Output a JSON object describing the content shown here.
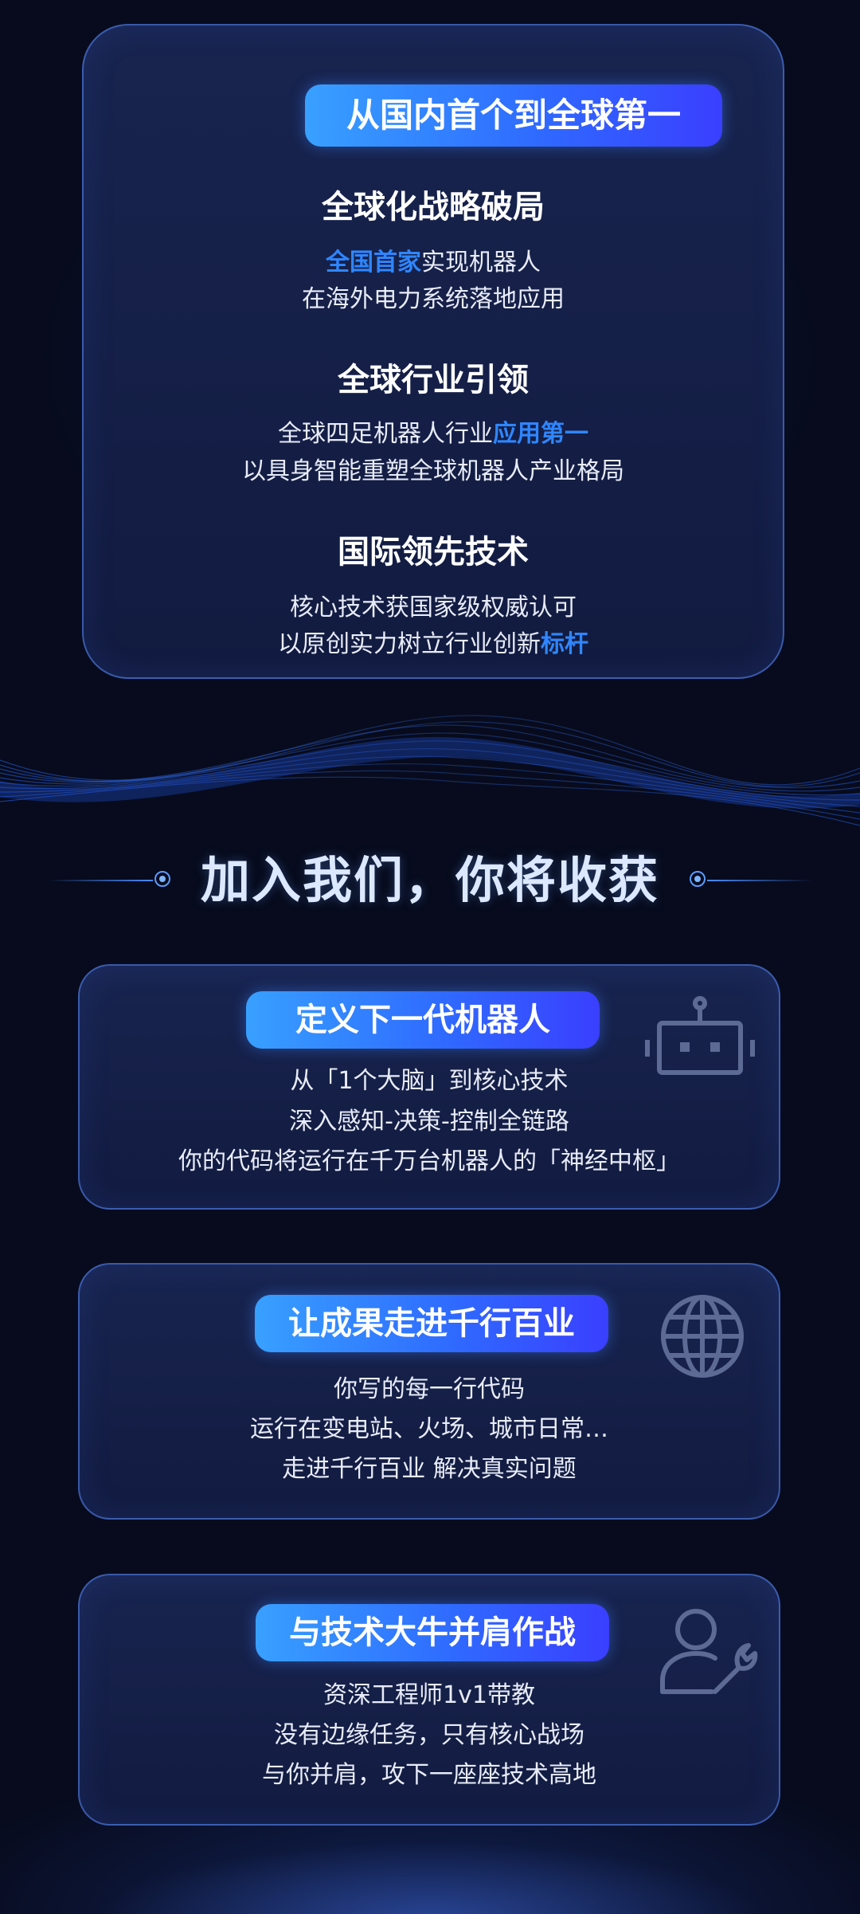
{
  "top_card": {
    "header": "从国内首个到全球第一",
    "sections": [
      {
        "title": "全球化战略破局",
        "line1_highlight": "全国首家",
        "line1_rest": "实现机器人",
        "line2": "在海外电力系统落地应用"
      },
      {
        "title": "全球行业引领",
        "line1_text": "全球四足机器人行业",
        "line1_highlight": "应用第一",
        "line2": "以具身智能重塑全球机器人产业格局"
      },
      {
        "title": "国际领先技术",
        "line1": "核心技术获国家级权威认可",
        "line2_text": "以原创实力树立行业创新",
        "line2_highlight": "标杆"
      }
    ]
  },
  "join": {
    "heading": "加入我们，你将收获"
  },
  "benefits": [
    {
      "title": "定义下一代机器人",
      "icon": "robot-icon",
      "lines": [
        "从「1个大脑」到核心技术",
        "深入感知-决策-控制全链路",
        "你的代码将运行在千万台机器人的「神经中枢」"
      ]
    },
    {
      "title": "让成果走进千行百业",
      "icon": "globe-icon",
      "lines": [
        "你写的每一行代码",
        "运行在变电站、火场、城市日常…",
        "走进千行百业  解决真实问题"
      ]
    },
    {
      "title": "与技术大牛并肩作战",
      "icon": "engineer-wrench-icon",
      "lines": [
        "资深工程师1v1带教",
        "没有边缘任务，只有核心战场",
        "与你并肩，攻下一座座技术高地"
      ]
    }
  ],
  "colors": {
    "background": "#070b1d",
    "card": "#18244f",
    "accent": "#2f86ff",
    "pill_start": "#38a0ff",
    "pill_end": "#3a3fff"
  }
}
